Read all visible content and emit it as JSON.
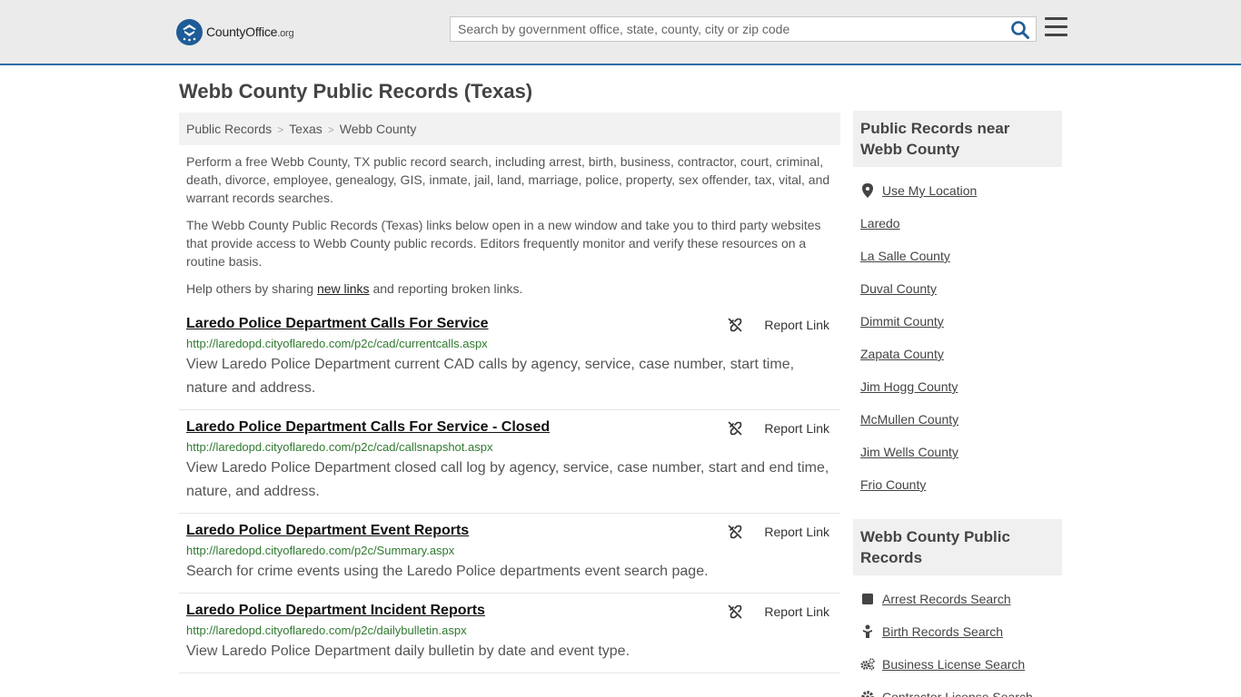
{
  "header": {
    "logo_text": "CountyOffice",
    "logo_suffix": ".org",
    "search_placeholder": "Search by government office, state, county, city or zip code"
  },
  "page_title": "Webb County Public Records (Texas)",
  "breadcrumb": [
    "Public Records",
    "Texas",
    "Webb County"
  ],
  "intro": {
    "p1": "Perform a free Webb County, TX public record search, including arrest, birth, business, contractor, court, criminal, death, divorce, employee, genealogy, GIS, inmate, jail, land, marriage, police, property, sex offender, tax, vital, and warrant records searches.",
    "p2": "The Webb County Public Records (Texas) links below open in a new window and take you to third party websites that provide access to Webb County public records. Editors frequently monitor and verify these resources on a routine basis.",
    "p3_before": "Help others by sharing ",
    "p3_link": "new links",
    "p3_after": " and reporting broken links."
  },
  "report_label": "Report Link",
  "records": [
    {
      "title": "Laredo Police Department Calls For Service",
      "url": "http://laredopd.cityoflaredo.com/p2c/cad/currentcalls.aspx",
      "desc": "View Laredo Police Department current CAD calls by agency, service, case number, start time, nature and address."
    },
    {
      "title": "Laredo Police Department Calls For Service - Closed",
      "url": "http://laredopd.cityoflaredo.com/p2c/cad/callsnapshot.aspx",
      "desc": "View Laredo Police Department closed call log by agency, service, case number, start and end time, nature, and address."
    },
    {
      "title": "Laredo Police Department Event Reports",
      "url": "http://laredopd.cityoflaredo.com/p2c/Summary.aspx",
      "desc": "Search for crime events using the Laredo Police departments event search page."
    },
    {
      "title": "Laredo Police Department Incident Reports",
      "url": "http://laredopd.cityoflaredo.com/p2c/dailybulletin.aspx",
      "desc": "View Laredo Police Department daily bulletin by date and event type."
    }
  ],
  "sidebar": {
    "near_heading": "Public Records near Webb County",
    "near_items": [
      "Use My Location",
      "Laredo",
      "La Salle County",
      "Duval County",
      "Dimmit County",
      "Zapata County",
      "Jim Hogg County",
      "McMullen County",
      "Jim Wells County",
      "Frio County"
    ],
    "records_heading": "Webb County Public Records",
    "records_items": [
      {
        "label": "Arrest Records Search",
        "icon": "square-icon"
      },
      {
        "label": "Birth Records Search",
        "icon": "baby-icon"
      },
      {
        "label": "Business License Search",
        "icon": "gears-icon"
      },
      {
        "label": "Contractor License Search",
        "icon": "gear-icon"
      }
    ]
  }
}
